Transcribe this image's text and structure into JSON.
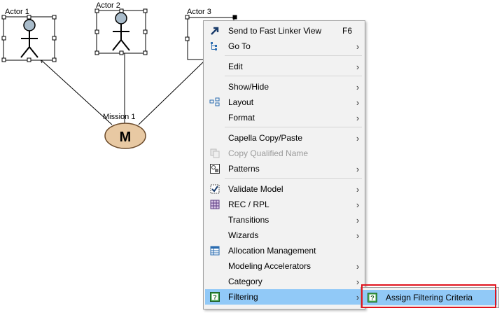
{
  "diagram": {
    "actors": [
      {
        "label": "Actor 1"
      },
      {
        "label": "Actor 2"
      },
      {
        "label": "Actor 3"
      }
    ],
    "mission": {
      "label": "Mission 1",
      "glyph": "M"
    }
  },
  "context_menu": {
    "items": [
      {
        "label": "Send to Fast Linker View",
        "shortcut": "F6",
        "icon": "fast-linker-arrow-icon",
        "has_submenu": false
      },
      {
        "label": "Go To",
        "icon": "goto-tree-icon",
        "has_submenu": true
      },
      {
        "label": "Edit",
        "has_submenu": true
      },
      {
        "label": "Show/Hide",
        "has_submenu": true
      },
      {
        "label": "Layout",
        "icon": "layout-icon",
        "has_submenu": true
      },
      {
        "label": "Format",
        "has_submenu": true
      },
      {
        "label": "Capella Copy/Paste",
        "has_submenu": true
      },
      {
        "label": "Copy Qualified Name",
        "icon": "copy-icon",
        "disabled": true
      },
      {
        "label": "Patterns",
        "icon": "patterns-icon",
        "has_submenu": true
      },
      {
        "label": "Validate Model",
        "icon": "validate-icon",
        "has_submenu": true
      },
      {
        "label": "REC / RPL",
        "icon": "rec-rpl-icon",
        "has_submenu": true
      },
      {
        "label": "Transitions",
        "has_submenu": true
      },
      {
        "label": "Wizards",
        "has_submenu": true
      },
      {
        "label": "Allocation Management",
        "icon": "allocation-table-icon"
      },
      {
        "label": "Modeling Accelerators",
        "has_submenu": true
      },
      {
        "label": "Category",
        "has_submenu": true
      },
      {
        "label": "Filtering",
        "icon": "filtering-icon",
        "has_submenu": true,
        "hovered": true
      }
    ],
    "submenu_arrow": "›"
  },
  "submenu": {
    "items": [
      {
        "label": "Assign Filtering Criteria",
        "icon": "assign-filter-icon"
      }
    ]
  },
  "colors": {
    "menu_bg": "#f2f2f2",
    "hover_bg": "#91c9f7",
    "highlight_border": "#e0141e",
    "mission_fill": "#e8c9a3"
  }
}
